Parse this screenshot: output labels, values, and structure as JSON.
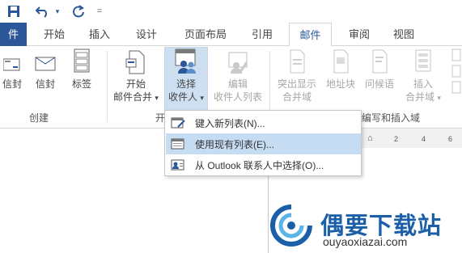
{
  "quick_access": {
    "save_icon": "save-icon",
    "undo_icon": "undo-icon",
    "redo_icon": "redo-icon",
    "customize_icon": "customize-qat-icon"
  },
  "tabs": [
    {
      "label": "件"
    },
    {
      "label": "开始"
    },
    {
      "label": "插入"
    },
    {
      "label": "设计"
    },
    {
      "label": "页面布局"
    },
    {
      "label": "引用"
    },
    {
      "label": "邮件"
    },
    {
      "label": "审阅"
    },
    {
      "label": "视图"
    }
  ],
  "ribbon": {
    "envelopes": "信封",
    "labels_envelope": "信封",
    "labels": "标签",
    "create_group": "创建",
    "start_mail_merge": {
      "line1": "开始",
      "line2": "邮件合并"
    },
    "select_recipients": {
      "line1": "选择",
      "line2": "收件人"
    },
    "edit_recipients": {
      "line1": "编辑",
      "line2": "收件人列表"
    },
    "start_group": "开",
    "highlight_fields": {
      "line1": "突出显示",
      "line2": "合并域"
    },
    "address_block": "地址块",
    "greeting_line": "问候语",
    "insert_field": {
      "line1": "插入",
      "line2": "合并域"
    },
    "write_insert_group": "编写和插入域"
  },
  "menu": {
    "items": [
      {
        "label": "键入新列表(N)..."
      },
      {
        "label": "使用现有列表(E)..."
      },
      {
        "label": "从 Outlook 联系人中选择(O)..."
      }
    ]
  },
  "ruler": {
    "ticks": [
      "2",
      "4",
      "6"
    ]
  },
  "watermark": {
    "title": "偶要下载站",
    "url": "ouyaoxiazai.com"
  },
  "colors": {
    "accent": "#2b579a",
    "menu_hover": "#c5dcf3",
    "pressed": "#cfdff2"
  }
}
